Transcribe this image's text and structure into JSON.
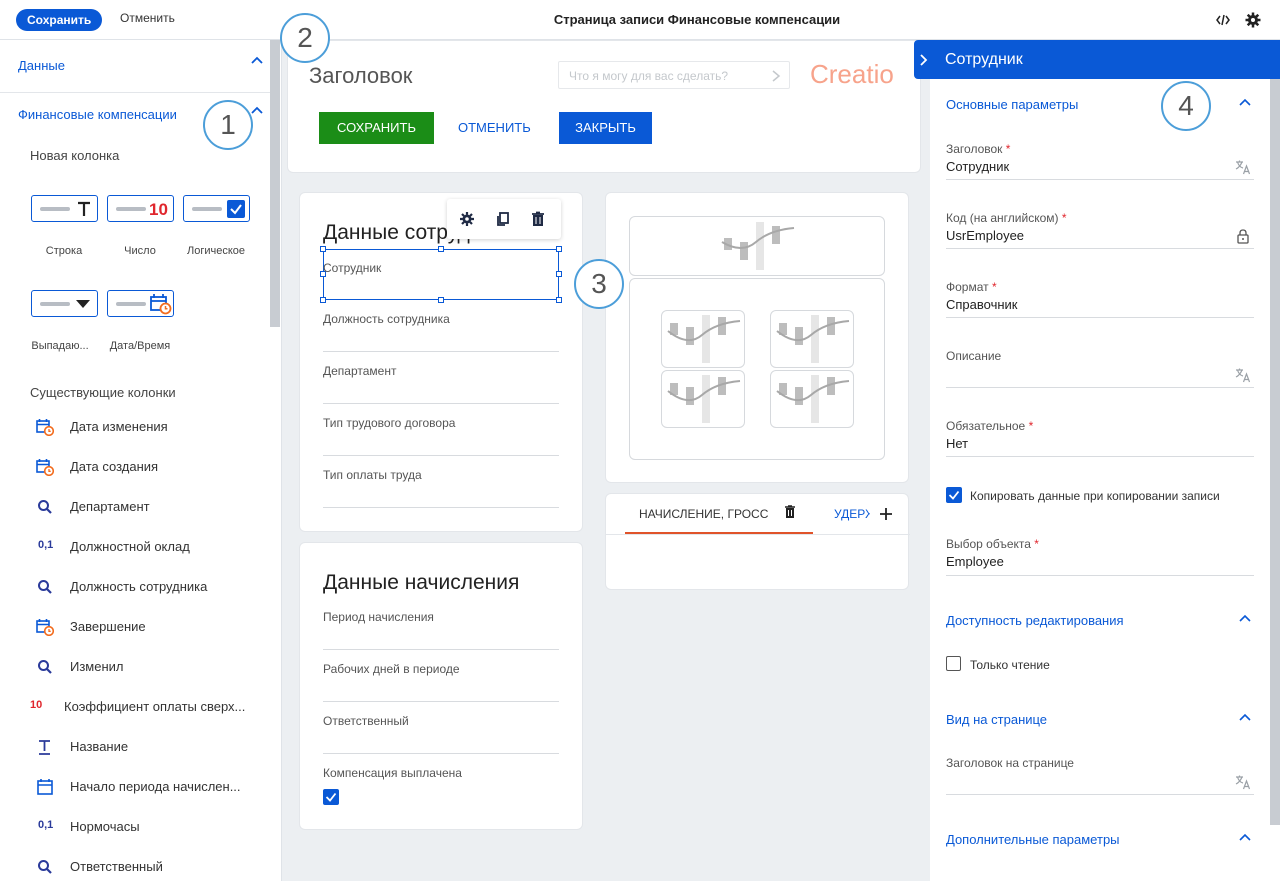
{
  "topbar": {
    "save": "Сохранить",
    "cancel": "Отменить",
    "title": "Страница записи Финансовые компенсации",
    "code_icon": "code-icon",
    "settings_icon": "gear-icon"
  },
  "left": {
    "data_section": "Данные",
    "object_section": "Финансовые компенсации",
    "new_column": "Новая колонка",
    "types": [
      {
        "label": "Строка",
        "icon": "text-icon"
      },
      {
        "label": "Число",
        "icon": "number-icon",
        "glyph": "10"
      },
      {
        "label": "Логическое",
        "icon": "checkbox-icon"
      },
      {
        "label": "Выпадаю...",
        "icon": "dropdown-icon"
      },
      {
        "label": "Дата/Время",
        "icon": "calendar-icon"
      }
    ],
    "existing_columns": "Существующие колонки",
    "columns": [
      {
        "label": "Дата изменения",
        "icon": "calendar-icon"
      },
      {
        "label": "Дата создания",
        "icon": "calendar-icon"
      },
      {
        "label": "Департамент",
        "icon": "search-icon"
      },
      {
        "label": "Должностной оклад",
        "icon": "decimal-icon",
        "glyph": "0,1"
      },
      {
        "label": "Должность сотрудника",
        "icon": "search-icon"
      },
      {
        "label": "Завершение",
        "icon": "calendar-icon"
      },
      {
        "label": "Изменил",
        "icon": "search-icon"
      },
      {
        "label": "Коэффициент оплаты сверх...",
        "icon": "number-icon",
        "glyph": "10"
      },
      {
        "label": "Название",
        "icon": "text-icon"
      },
      {
        "label": "Начало периода начислен...",
        "icon": "date-icon"
      },
      {
        "label": "Нормочасы",
        "icon": "decimal-icon",
        "glyph": "0,1"
      },
      {
        "label": "Ответственный",
        "icon": "search-icon"
      }
    ]
  },
  "canvas": {
    "header_title": "Заголовок",
    "search_placeholder": "Что я могу для вас сделать?",
    "logo": "Creatio",
    "btn_save": "СОХРАНИТЬ",
    "btn_cancel": "ОТМЕНИТЬ",
    "btn_close": "ЗАКРЫТЬ",
    "group1_title": "Данные сотрудника",
    "group1_fields": [
      "Сотрудник",
      "Должность сотрудника",
      "Департамент",
      "Тип трудового договора",
      "Тип оплаты труда"
    ],
    "group2_title": "Данные начисления",
    "group2_fields": [
      "Период начисления",
      "Рабочих дней в периоде",
      "Ответственный",
      "Компенсация выплачена"
    ],
    "tab1": "НАЧИСЛЕНИЕ, ГРОСС",
    "tab2": "УДЕРЖ"
  },
  "callouts": [
    "1",
    "2",
    "3",
    "4"
  ],
  "right": {
    "title": "Сотрудник",
    "sec_main": "Основные параметры",
    "f_title_lbl": "Заголовок",
    "f_title_val": "Сотрудник",
    "f_code_lbl": "Код (на английском)",
    "f_code_val": "UsrEmployee",
    "f_format_lbl": "Формат",
    "f_format_val": "Справочник",
    "f_desc_lbl": "Описание",
    "f_req_lbl": "Обязательное",
    "f_req_val": "Нет",
    "copy_chk": "Копировать данные при копировании записи",
    "f_obj_lbl": "Выбор объекта",
    "f_obj_val": "Employee",
    "sec_edit": "Доступность редактирования",
    "readonly_chk": "Только чтение",
    "sec_view": "Вид на странице",
    "f_caption_lbl": "Заголовок на странице",
    "sec_extra": "Дополнительные параметры",
    "required_mark": "*",
    "colors": {
      "accent": "#0a59d6",
      "green": "#1b8d17",
      "danger": "#e0262d"
    }
  }
}
